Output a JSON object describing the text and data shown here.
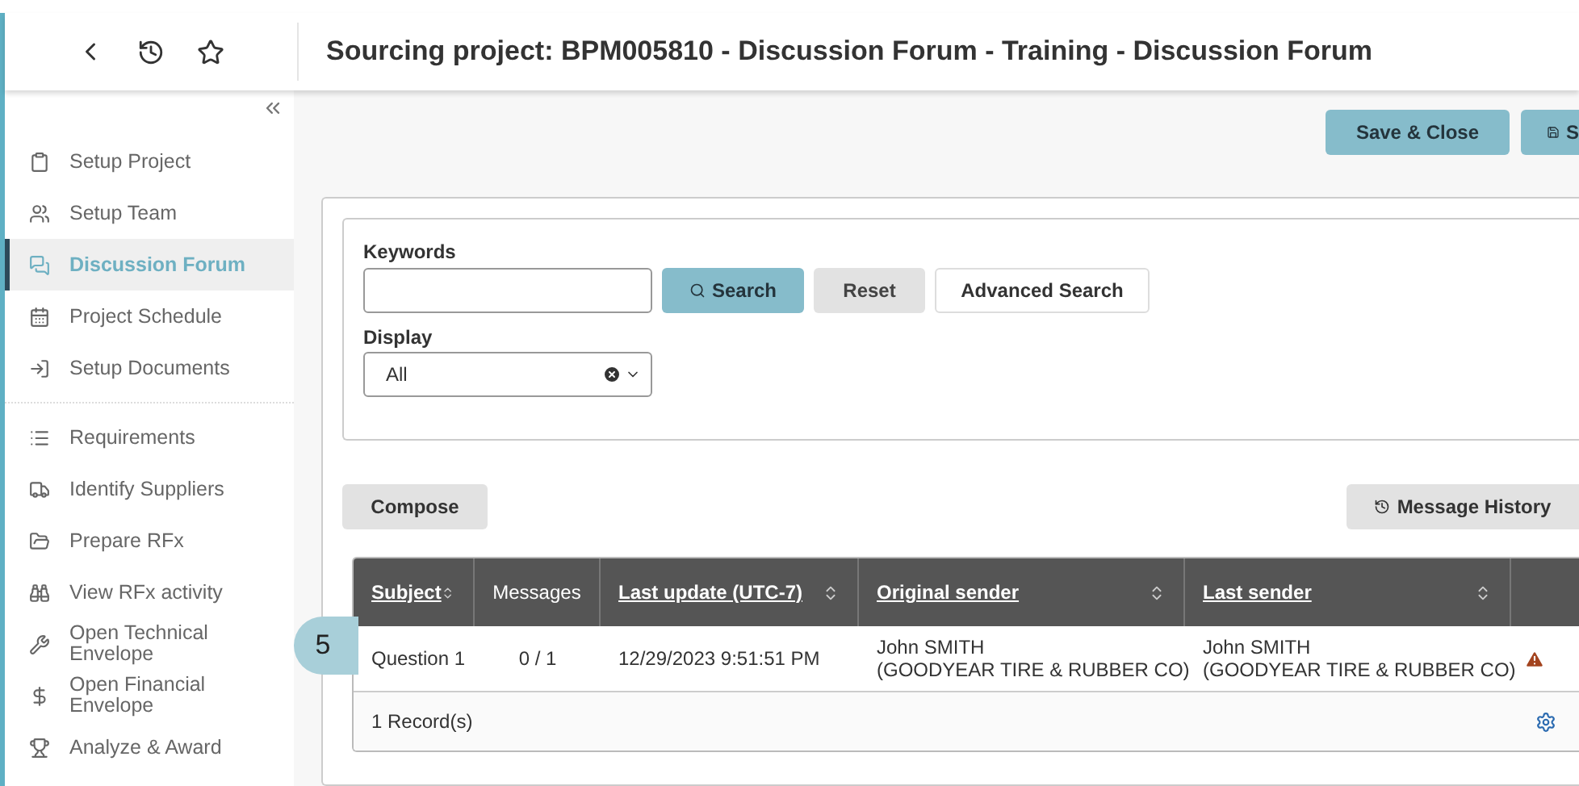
{
  "header": {
    "title": "Sourcing project: BPM005810 - Discussion Forum - Training - Discussion Forum"
  },
  "sidebar": {
    "items": [
      {
        "label": "Setup Project",
        "selected": false
      },
      {
        "label": "Setup Team",
        "selected": false
      },
      {
        "label": "Discussion Forum",
        "selected": true
      },
      {
        "label": "Project Schedule",
        "selected": false
      },
      {
        "label": "Setup Documents",
        "selected": false
      },
      {
        "label": "Requirements",
        "selected": false
      },
      {
        "label": "Identify Suppliers",
        "selected": false
      },
      {
        "label": "Prepare RFx",
        "selected": false
      },
      {
        "label": "View RFx activity",
        "selected": false
      },
      {
        "label": "Open Technical Envelope",
        "selected": false
      },
      {
        "label": "Open Financial Envelope",
        "selected": false
      },
      {
        "label": "Analyze & Award",
        "selected": false
      }
    ]
  },
  "toolbar": {
    "buttons": [
      "Save & Close",
      "S"
    ]
  },
  "search": {
    "keywords_label": "Keywords",
    "search_button": "Search",
    "reset_button": "Reset",
    "advanced_button": "Advanced Search",
    "display_label": "Display",
    "display_value": "All"
  },
  "actions": {
    "compose": "Compose",
    "history": "Message History"
  },
  "table": {
    "columns": [
      {
        "label": "Subject",
        "sortable": true
      },
      {
        "label": "Messages",
        "sortable": false
      },
      {
        "label": "Last update (UTC-7)",
        "sortable": true
      },
      {
        "label": "Original sender",
        "sortable": true
      },
      {
        "label": "Last sender",
        "sortable": true
      }
    ],
    "rows": [
      {
        "cells": [
          "Question 1",
          "0 / 1",
          "12/29/2023 9:51:51 PM",
          "John SMITH\n(GOODYEAR TIRE & RUBBER CO)",
          "John SMITH\n(GOODYEAR TIRE & RUBBER CO)"
        ],
        "warning": true
      }
    ],
    "footer": "1 Record(s)"
  },
  "callout": {
    "label": "5"
  }
}
